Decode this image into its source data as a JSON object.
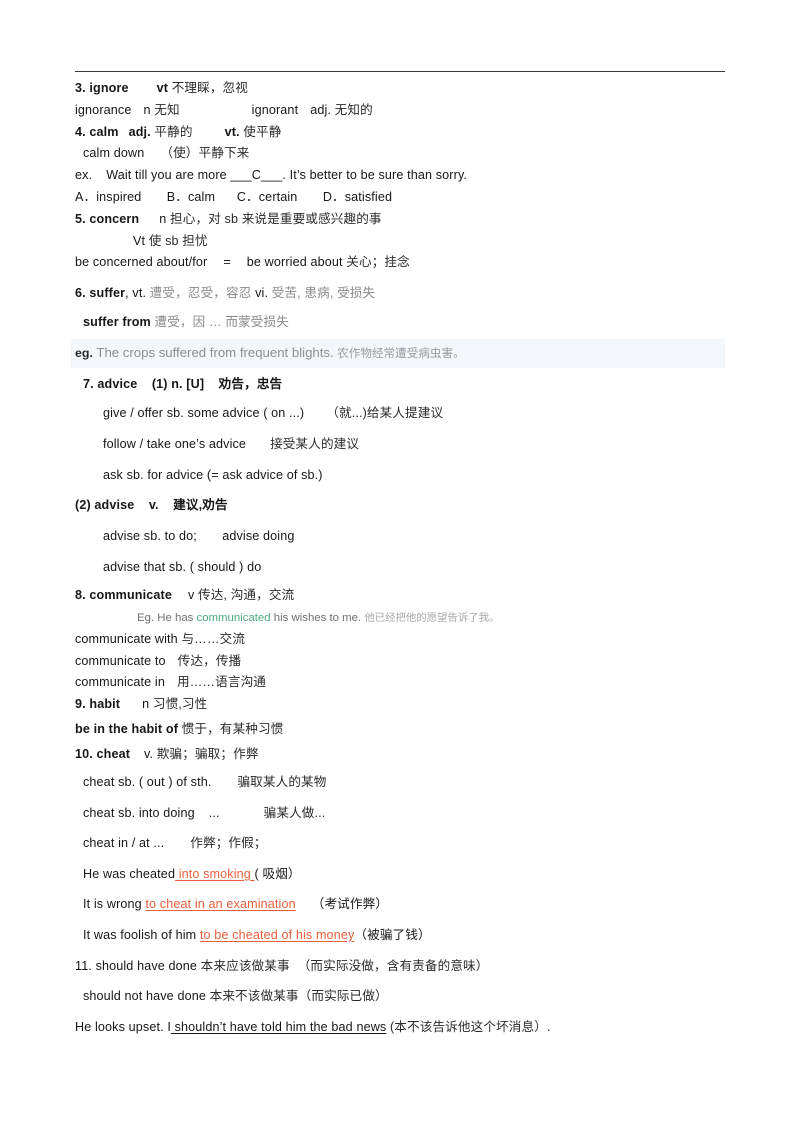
{
  "document": {
    "type": "english-vocabulary-study-notes",
    "header_rule": true,
    "colors": {
      "text": "#171717",
      "chinese_gray": "#8a8a8a",
      "highlight_green": "#4cab7d",
      "underline_orange": "#ea5f3c",
      "eg_band_background": "#f3f6fb"
    }
  },
  "entries": {
    "e3": {
      "line1_head": "3. ignore",
      "line1_pos": "vt",
      "line1_cn": "不理睬，忽视",
      "line2_a_word": "ignorance",
      "line2_a_pos": "n",
      "line2_a_cn": "无知",
      "line2_b_word": "ignorant",
      "line2_b_pos": "adj.",
      "line2_b_cn": "无知的"
    },
    "e4": {
      "line1_head": "4. calm",
      "line1_pos1": "adj.",
      "line1_cn1": "平静的",
      "line1_pos2": "vt.",
      "line1_cn2": "使平静",
      "line2_phrase": "calm down",
      "line2_cn": "（使）平静下来",
      "ex_label": "ex.",
      "ex_sentence": "Wait till you are more ___C___. It’s better to be sure than sorry.",
      "options": "A．inspired       B．calm      C．certain       D．satisfied"
    },
    "e5": {
      "line1_head": "5. concern",
      "line1_pos": "n",
      "line1_cn": "担心，对 sb 来说是重要或感兴趣的事",
      "line2_pos": "Vt",
      "line2_cn": "使 sb 担忧",
      "line3_left": "be concerned about/for",
      "line3_eq": "=",
      "line3_right": "be worried about",
      "line3_cn": "关心；挂念"
    },
    "e6": {
      "line1_head": "6. suffer",
      "line1_rest": ", vt.",
      "line1_cn1": "遭受，忍受，容忍",
      "line1_pos2": "vi.",
      "line1_cn2": "受苦, 患病, 受损失",
      "line2_phrase": "suffer from",
      "line2_cn": "遭受，因 … 而蒙受损失",
      "eg_label": "eg.",
      "eg_text": "The crops suffered from frequent blights.",
      "eg_cn": "农作物经常遭受病虫害。"
    },
    "e7": {
      "line1": "7. advice    (1) n. [U]    劝告，忠告",
      "line2_en": "give / offer sb. some advice ( on ...)",
      "line2_cn": "（就...)给某人提建议",
      "line3_en": "follow / take one’s advice",
      "line3_cn": "接受某人的建议",
      "line4_en": "ask sb. for advice (= ask advice of sb.)",
      "sub_head": "(2) advise    v.    建议,劝告",
      "sub_line1": "advise sb. to do;       advise doing",
      "sub_line2": "advise that sb. ( should ) do"
    },
    "e8": {
      "line1_head": "8. communicate",
      "line1_pos": "v",
      "line1_cn": "传达, 沟通，交流",
      "eg_label": "Eg. He has",
      "eg_highlight": "communicated",
      "eg_rest": "his wishes to me.",
      "eg_cn": "他已经把他的愿望告诉了我。",
      "p1_en": "communicate with",
      "p1_cn": "与……交流",
      "p2_en": "communicate to",
      "p2_cn": "传达，传播",
      "p3_en": "communicate in",
      "p3_cn": "用……语言沟通"
    },
    "e9": {
      "line1_head": "9. habit",
      "line1_pos": "n",
      "line1_cn": "习惯,习性",
      "line2_en": "be in the habit of",
      "line2_cn": "惯于，有某种习惯"
    },
    "e10": {
      "line1_head": "10. cheat",
      "line1_pos": "v.",
      "line1_cn": "欺骗；骗取；作弊",
      "p1_en": "cheat sb. ( out ) of sth.",
      "p1_cn": "骗取某人的某物",
      "p2_en": "cheat sb. into doing",
      "p2_dots": "...",
      "p2_cn": "骗某人做...",
      "p3_en": "cheat in / at ...",
      "p3_cn": "作弊；作假；",
      "s1_pre": "He was cheated",
      "s1_underline": " into smoking ",
      "s1_post": "( 吸烟）",
      "s2_pre": "It is wrong ",
      "s2_underline": "to cheat in an examination",
      "s2_post": "（考试作弊）",
      "s3_pre": "It was foolish of him ",
      "s3_underline": "to be cheated of his money",
      "s3_post": "（被骗了钱）"
    },
    "e11": {
      "line1_head": "11. should have done",
      "line1_cn": "本来应该做某事",
      "line1_note": "（而实际没做，含有责备的意味）",
      "line2_head": "should not have done",
      "line2_cn": "本来不该做某事（而实际已做）",
      "line3_pre": "He looks upset. I",
      "line3_underline": " shouldn’t have told him the bad news",
      "line3_post": " (本不该告诉他这个坏消息）.",
      "line3_underline_full": "shouldn’t have told him the bad news"
    }
  }
}
